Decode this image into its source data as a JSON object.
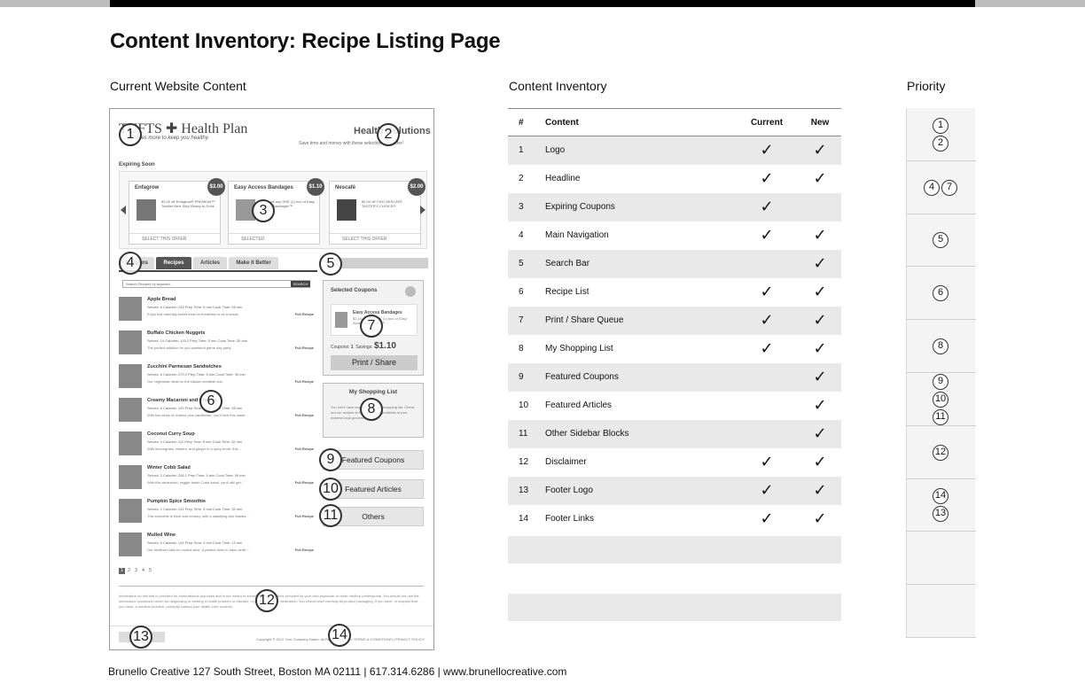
{
  "page": {
    "title": "Content Inventory: Recipe Listing Page",
    "col_current": "Current Website Content",
    "col_inventory": "Content Inventory",
    "col_priority": "Priority",
    "footer": "Brunello Creative 127 South Street, Boston MA 02111 | 617.314.6286 | www.brunellocreative.com"
  },
  "mockup": {
    "logo": "TUFTS ✚ Health Plan",
    "logo_tag": "... does more to keep you healthy.",
    "header_title": "Health Solutions",
    "header_sub": "Save time and money with these selections you offer!",
    "expiring_label": "Expiring Soon",
    "coupons": [
      {
        "name": "Enfagrow",
        "badge": "$3.00",
        "desc": "$3.00 off Enfagrow® PREMIUM™ Toddler Next Step Ready-to-Drink",
        "foot": "SELECT THIS OFFER"
      },
      {
        "name": "Easy Access Bandages",
        "badge": "$1.10",
        "desc": "$1.10 off any ONE (1) box of Easy Access Bandages™",
        "foot": "SELECTED"
      },
      {
        "name": "Nescafé",
        "badge": "$2.00",
        "desc": "$2.00 off TWO NESCAFÉ TASTER'S CHOICE®",
        "foot": "SELECT THIS OFFER"
      }
    ],
    "tabs": [
      "Coupons",
      "Recipes",
      "Articles",
      "Make it Better"
    ],
    "search_placeholder": "Search Recipes by keyword...",
    "search_btn": "SEARCH",
    "recipes": [
      {
        "title": "Apple Bread",
        "meta": "Serves: 8    Calories: 243    Prep Time: 5 min    Cook Time: 55 min",
        "desc": "Enjoy this naturally sweet treat for breakfast or as a snack.",
        "link": "Full Recipe"
      },
      {
        "title": "Buffalo Chicken Nuggets",
        "meta": "Serves: 10    Calories: 100.2    Prep Time: 5 min    Cook Time: 30 min",
        "desc": "The perfect addition for you weekend game day party.",
        "link": "Full Recipe"
      },
      {
        "title": "Zucchini Parmesan Sandwiches",
        "meta": "Serves: 6    Calories: 279.2    Prep Time: 5 min    Cook Time: 30 min",
        "desc": "Our vegetarian twist on the classic meatball sub.",
        "link": "Full Recipe"
      },
      {
        "title": "Creamy Macaroni and Cheese",
        "meta": "Serves: 8    Calories: 100    Prep Time: 5 min    Cook Time: 55 min",
        "desc": "With two kinds of cheese plus cauliflower, you'll love this made...",
        "link": "Full Recipe"
      },
      {
        "title": "Coconut Curry Soup",
        "meta": "Serves: 4    Calories: 112    Prep Time: 5 min    Cook Time: 32 min",
        "desc": "With lemongrass, cilantro, and ginger in a spicy broth, this...",
        "link": "Full Recipe"
      },
      {
        "title": "Winter Cobb Salad",
        "meta": "Serves: 2    Calories: 206.1    Prep Time: 5 min    Cook Time: 50 min",
        "desc": "With this winterized, veggie-laden Cobb salad, you'll still get...",
        "link": "Full Recipe"
      },
      {
        "title": "Pumpkin Spice Smoothie",
        "meta": "Serves: 2    Calories: 131    Prep Time: 5 min    Cook Time: 30 min",
        "desc": "This smoothie is thick and creamy, with a satisfying kick thanks...",
        "link": "Full Recipe"
      },
      {
        "title": "Mulled Wine",
        "meta": "Serves: 6    Calories: 126    Prep Time: 4 min    Cook Time: 12 min",
        "desc": "Our healthier take on mulled wine. A perfect drink to have while...",
        "link": "Full Recipe"
      }
    ],
    "pages": [
      "1",
      "2",
      "3",
      "4",
      "5"
    ],
    "disclaimer": "Information on this site is provided for informational purposes and is not meant to substitute for the advice provided by your own physician or other medical professional. You should not use the information contained herein for diagnosing or treating a health problem or disease, or prescribing any medication. You should read carefully all product packaging. If you have, or suspect that you have, a medical problem, promptly contact your health care provider.",
    "footer_links": "Copyright © 2012 Your Company Name. All Rights Reserved.    TERMS & CONDITIONS  |  PRIVACY POLICY",
    "selected": {
      "title": "Selected Coupons",
      "item_name": "Easy Access Bandages",
      "item_desc": "$1.10 off any ONE (1) box of Easy Access Bandages™",
      "coupons_label": "Coupons:",
      "coupons_val": "1",
      "savings_label": "Savings:",
      "savings_val": "$1.10",
      "button": "Print / Share"
    },
    "shopping": {
      "title": "My Shopping List",
      "body": "You don't have any items in your shopping list. Check out our recipes to find on-sale ingredients at your nearest local grocers."
    },
    "featured_coupons": "Featured Coupons",
    "featured_articles": "Featured Articles",
    "others": "Others",
    "markers": [
      "1",
      "2",
      "3",
      "4",
      "5",
      "6",
      "7",
      "8",
      "9",
      "10",
      "11",
      "12",
      "13",
      "14"
    ]
  },
  "inventory": {
    "headers": {
      "num": "#",
      "content": "Content",
      "current": "Current",
      "new": "New"
    },
    "check": "✓",
    "rows": [
      {
        "num": "1",
        "content": "Logo",
        "current": true,
        "new": true
      },
      {
        "num": "2",
        "content": "Headline",
        "current": true,
        "new": true
      },
      {
        "num": "3",
        "content": "Expiring Coupons",
        "current": true,
        "new": false
      },
      {
        "num": "4",
        "content": "Main Navigation",
        "current": true,
        "new": true
      },
      {
        "num": "5",
        "content": "Search Bar",
        "current": false,
        "new": true
      },
      {
        "num": "6",
        "content": "Recipe List",
        "current": true,
        "new": true
      },
      {
        "num": "7",
        "content": "Print / Share Queue",
        "current": true,
        "new": true
      },
      {
        "num": "8",
        "content": "My Shopping List",
        "current": true,
        "new": true
      },
      {
        "num": "9",
        "content": "Featured Coupons",
        "current": false,
        "new": true
      },
      {
        "num": "10",
        "content": "Featured Articles",
        "current": false,
        "new": true
      },
      {
        "num": "11",
        "content": "Other Sidebar Blocks",
        "current": false,
        "new": true
      },
      {
        "num": "12",
        "content": "Disclaimer",
        "current": true,
        "new": true
      },
      {
        "num": "13",
        "content": "Footer Logo",
        "current": true,
        "new": true
      },
      {
        "num": "14",
        "content": "Footer Links",
        "current": true,
        "new": true
      }
    ]
  },
  "priority": {
    "groups": [
      [
        "1",
        "2"
      ],
      [
        "4",
        "7"
      ],
      [
        "5"
      ],
      [
        "6"
      ],
      [
        "8"
      ],
      [
        "9",
        "10",
        "11"
      ],
      [
        "12"
      ],
      [
        "14",
        "13"
      ],
      [],
      []
    ]
  }
}
